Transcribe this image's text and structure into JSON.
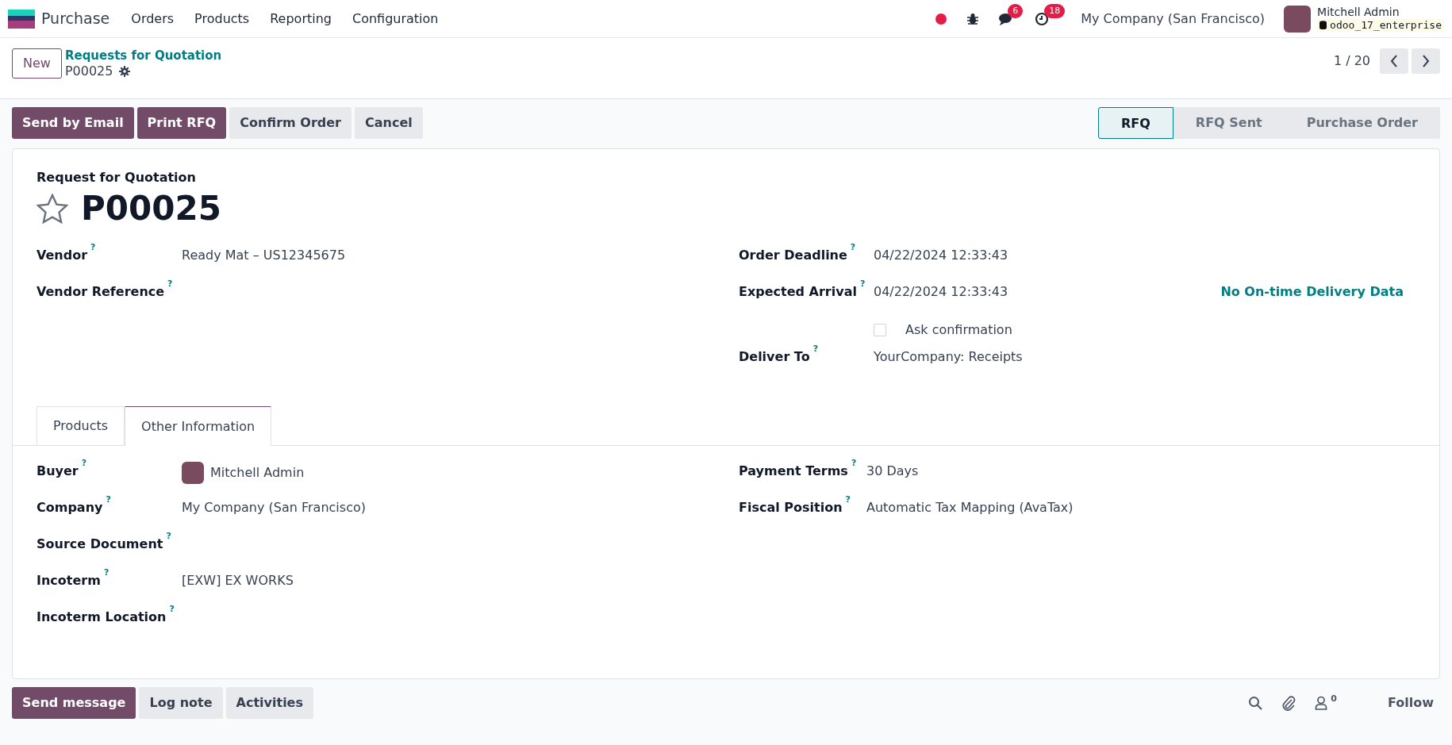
{
  "navbar": {
    "app_name": "Purchase",
    "menus": [
      "Orders",
      "Products",
      "Reporting",
      "Configuration"
    ],
    "chat_count": "6",
    "activity_count": "18",
    "company": "My Company (San Francisco)",
    "user": {
      "name": "Mitchell Admin",
      "database": "odoo_17_enterprise"
    }
  },
  "control_panel": {
    "new_button": "New",
    "breadcrumb": {
      "parent": "Requests for Quotation",
      "current": "P00025"
    },
    "pager": "1 / 20"
  },
  "actions": [
    {
      "label": "Send by Email",
      "kind": "primary"
    },
    {
      "label": "Print RFQ",
      "kind": "primary"
    },
    {
      "label": "Confirm Order",
      "kind": "secondary"
    },
    {
      "label": "Cancel",
      "kind": "secondary"
    }
  ],
  "statusbar": [
    {
      "label": "RFQ",
      "selected": true
    },
    {
      "label": "RFQ Sent",
      "selected": false
    },
    {
      "label": "Purchase Order",
      "selected": false
    }
  ],
  "form": {
    "title_label": "Request for Quotation",
    "name": "P00025",
    "starred": false,
    "left_fields": [
      {
        "label": "Vendor",
        "help": "?",
        "value": "Ready Mat – US12345675"
      },
      {
        "label": "Vendor Reference",
        "help": "?"
      }
    ],
    "right_fields": [
      {
        "kind": "field",
        "label": "Order Deadline",
        "help": "?",
        "value": "04/22/2024 12:33:43"
      },
      {
        "kind": "field",
        "label": "Expected Arrival",
        "help": "?",
        "value": "04/22/2024 12:33:43",
        "note": "No On-time Delivery Data"
      },
      {
        "kind": "checkbox",
        "label": "Ask confirmation",
        "checked": false
      },
      {
        "kind": "field",
        "label": "Deliver To",
        "help": "?",
        "value": "YourCompany: Receipts"
      }
    ],
    "tabs": [
      {
        "label": "Products",
        "selected": false
      },
      {
        "label": "Other Information",
        "selected": true
      }
    ],
    "tab_left_fields": [
      {
        "label": "Buyer",
        "help": "?",
        "value": "Mitchell Admin",
        "avatar": true
      },
      {
        "label": "Company",
        "help": "?",
        "value": "My Company (San Francisco)"
      },
      {
        "label": "Source Document",
        "help": "?"
      },
      {
        "label": "Incoterm",
        "help": "?",
        "value": "[EXW] EX WORKS"
      },
      {
        "label": "Incoterm Location",
        "help": "?"
      }
    ],
    "tab_right_fields": [
      {
        "label": "Payment Terms",
        "help": "?",
        "value": "30 Days"
      },
      {
        "label": "Fiscal Position",
        "help": "?",
        "value": "Automatic Tax Mapping (AvaTax)"
      }
    ]
  },
  "chatter": {
    "buttons": [
      {
        "label": "Send message",
        "kind": "primary"
      },
      {
        "label": "Log note",
        "kind": "secondary"
      },
      {
        "label": "Activities",
        "kind": "secondary"
      }
    ],
    "follower_count": "0",
    "follow": "Follow"
  }
}
